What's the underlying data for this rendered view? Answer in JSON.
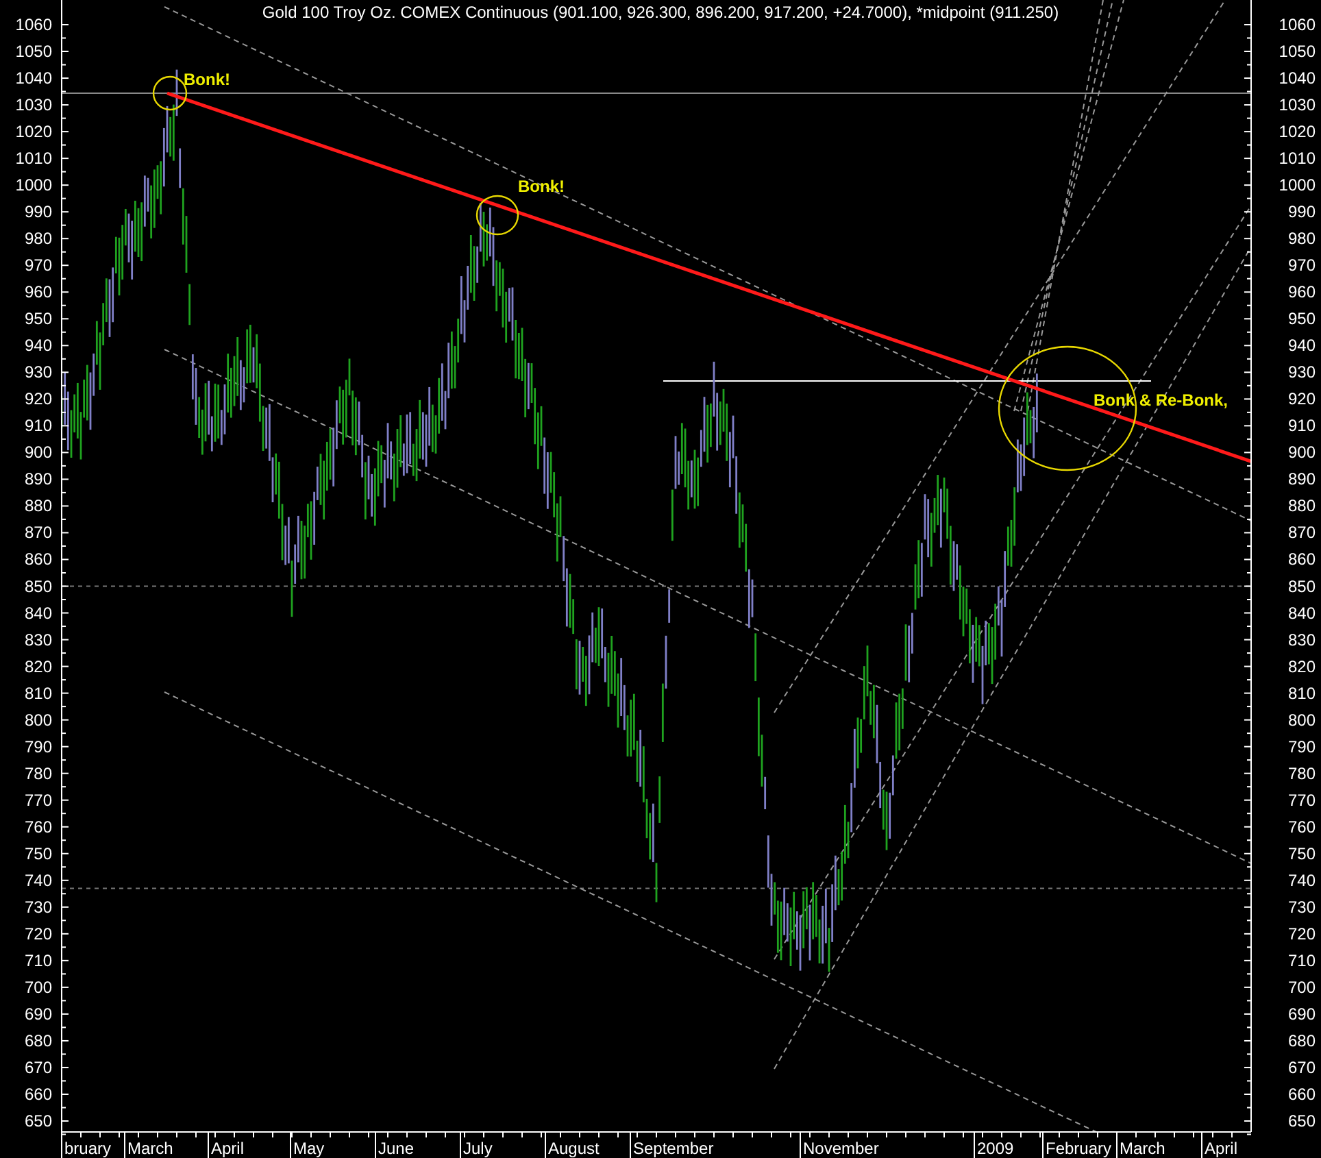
{
  "chart": {
    "title": "Gold 100 Troy Oz. COMEX Continuous (901.100, 926.300, 896.200, 917.200, +24.7000), *midpoint (911.250)",
    "annotations": [
      "Bonk!",
      "Bonk!",
      "Bonk & Re-Bonk,"
    ],
    "left_axis_labels": [
      "1060",
      "1050",
      "1040",
      "1030",
      "1020",
      "1010",
      "1000",
      "990",
      "980",
      "970",
      "960",
      "950",
      "940",
      "930",
      "920",
      "910",
      "900",
      "890",
      "880",
      "870",
      "860",
      "850",
      "840",
      "830",
      "820",
      "810",
      "800",
      "790",
      "780",
      "770",
      "760",
      "750",
      "740",
      "730",
      "720",
      "710",
      "700",
      "690",
      "680",
      "670",
      "660",
      "650"
    ],
    "right_axis_labels": [
      "1060",
      "1050",
      "1040",
      "1030",
      "1020",
      "1010",
      "1000",
      "990",
      "980",
      "970",
      "960",
      "950",
      "940",
      "930",
      "920",
      "910",
      "900",
      "890",
      "880",
      "870",
      "860",
      "850",
      "840",
      "830",
      "820",
      "810",
      "800",
      "790",
      "780",
      "770",
      "760",
      "750",
      "740",
      "730",
      "720",
      "710",
      "700",
      "690",
      "680",
      "670",
      "660",
      "650"
    ],
    "x_axis_labels": [
      "bruary",
      "March",
      "April",
      "May",
      "June",
      "July",
      "August",
      "September",
      "November",
      "2009",
      "February",
      "March",
      "April"
    ]
  }
}
